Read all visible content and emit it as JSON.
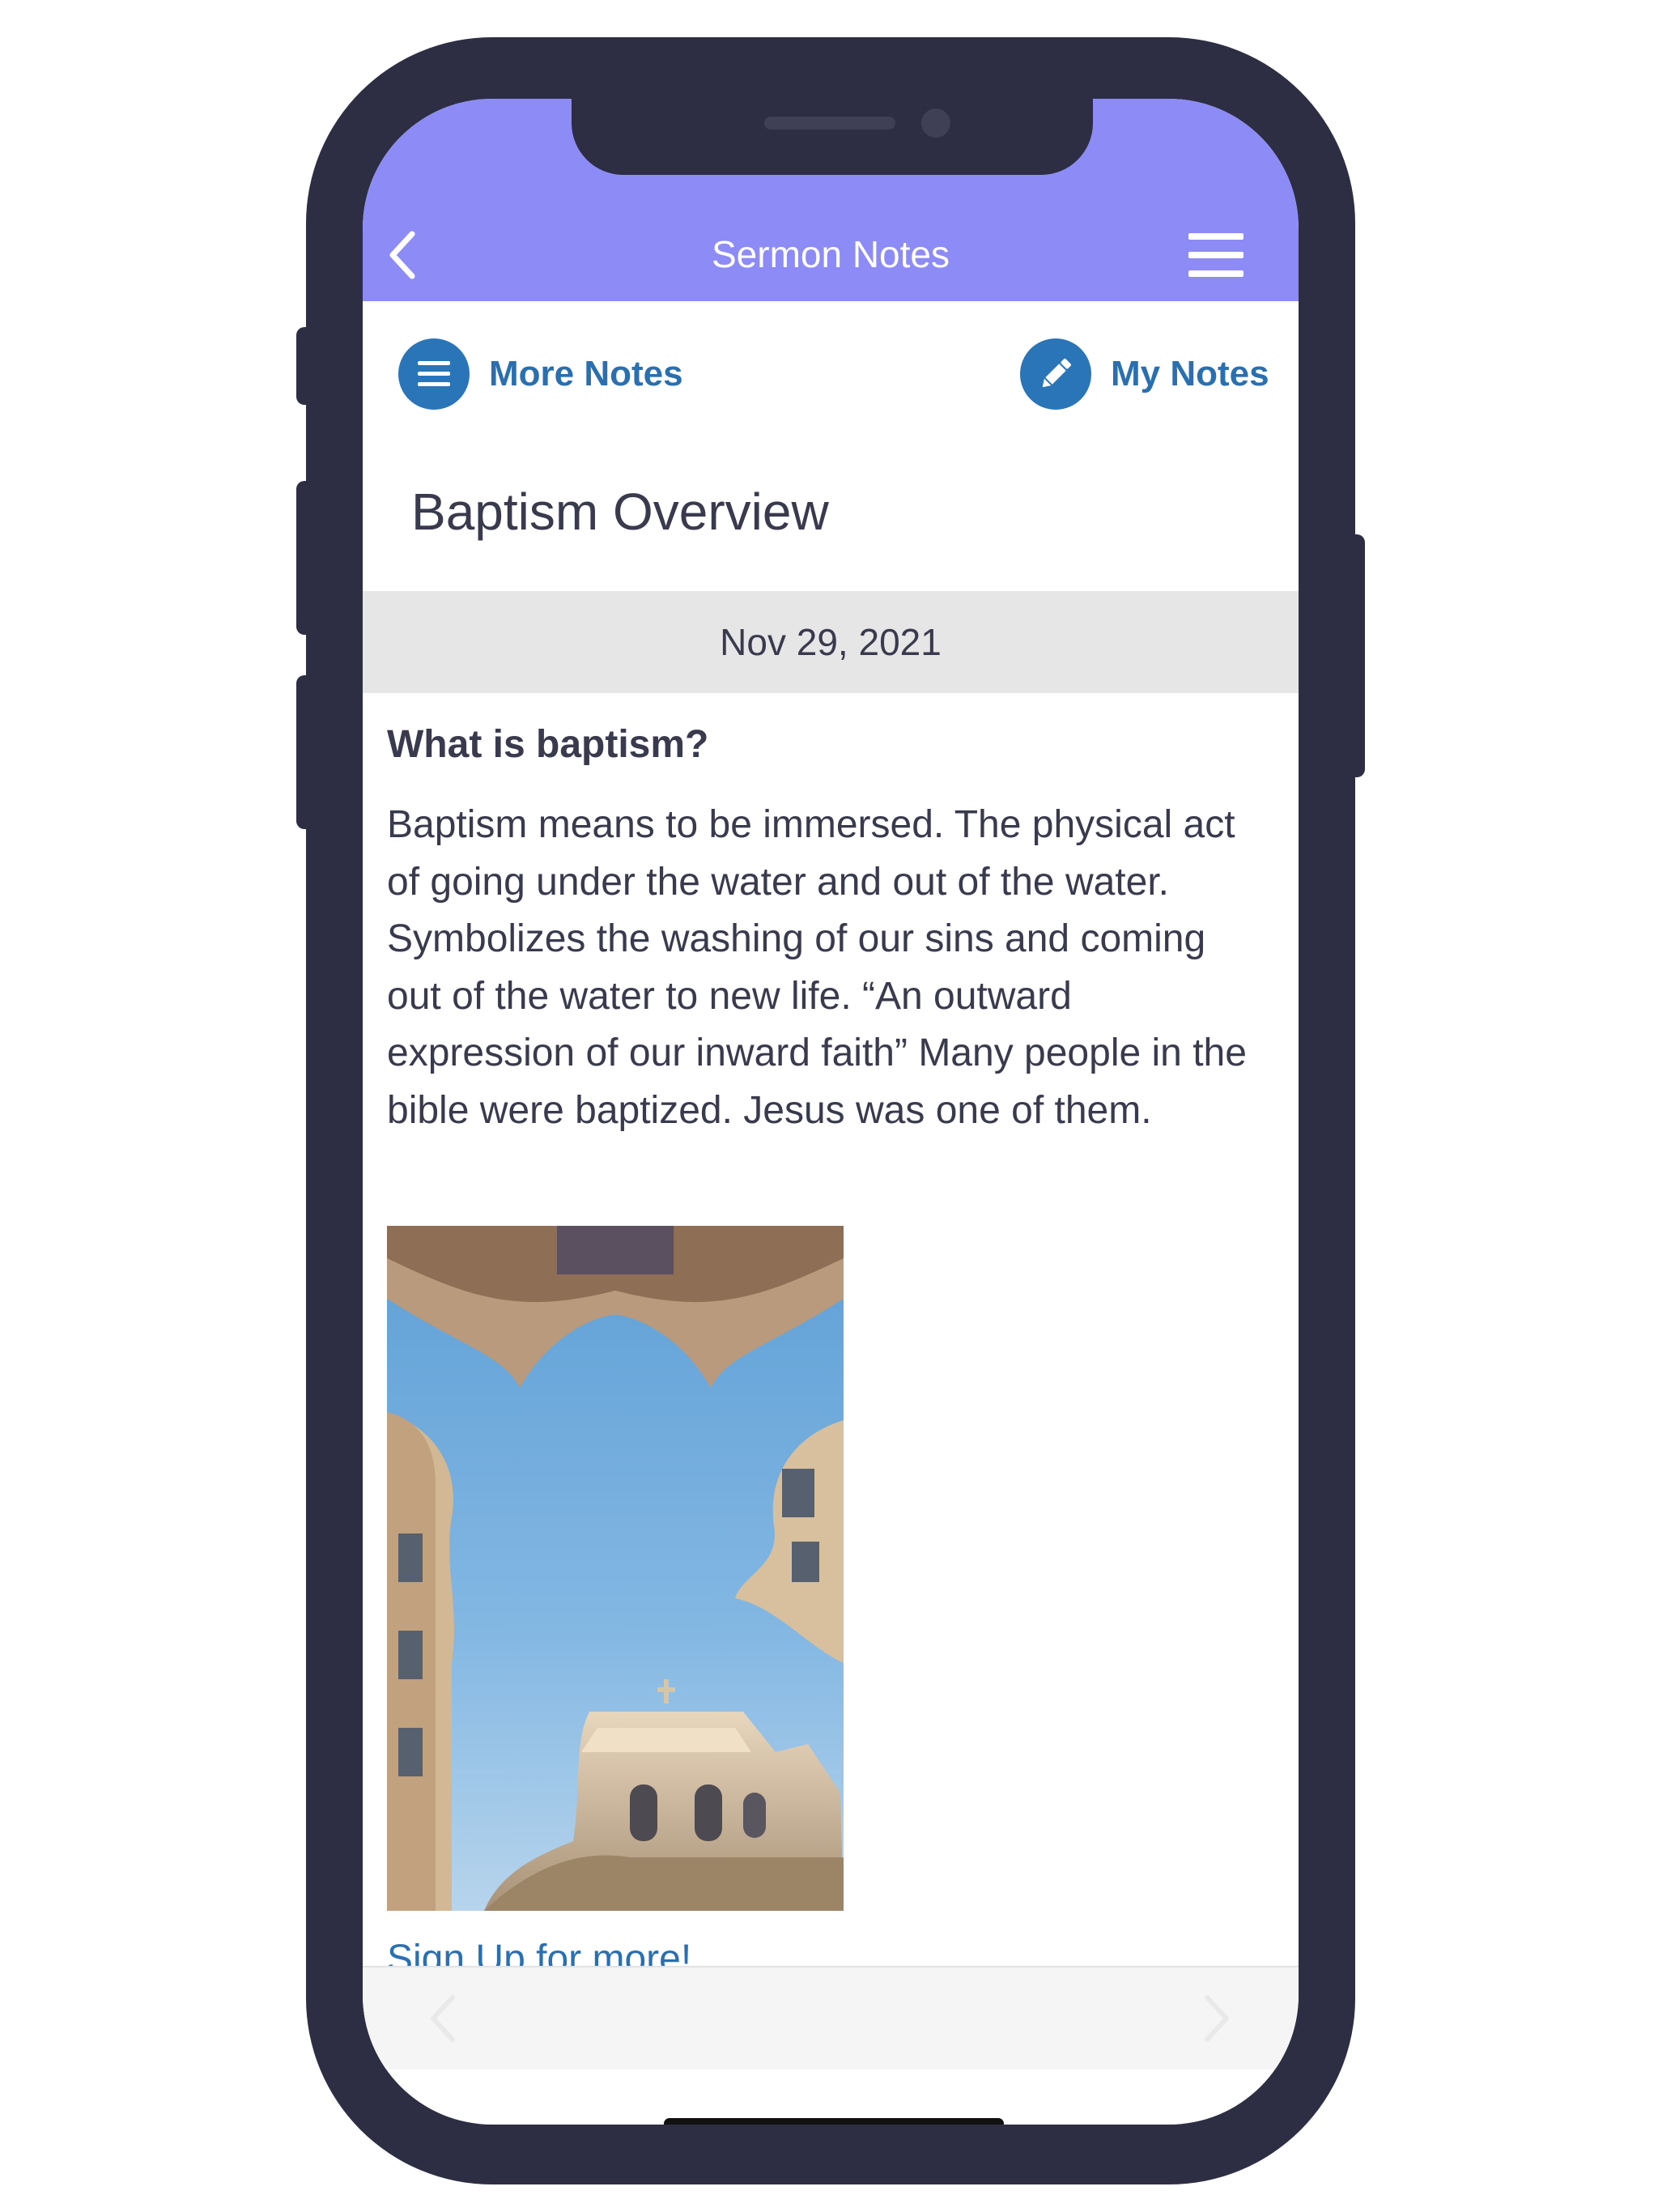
{
  "header": {
    "title": "Sermon Notes",
    "back_icon": "chevron-left-icon",
    "menu_icon": "hamburger-menu-icon",
    "background": "#8d8cf6"
  },
  "actions": {
    "more_notes": {
      "label": "More Notes",
      "icon": "list-icon"
    },
    "my_notes": {
      "label": "My Notes",
      "icon": "pencil-icon"
    },
    "accent": "#2a74b8"
  },
  "note": {
    "title": "Baptism Overview",
    "date": "Nov 29, 2021",
    "heading": "What is baptism?",
    "body": "Baptism means to be immersed. The physical act of going under the water and out of the water. Symbolizes the washing of our sins and coming out of the water to new life. “An outward expression of our inward faith” Many people in the bible were baptized. Jesus was one of them.",
    "link_text": "Sign Up for more!"
  },
  "bottom_nav": {
    "prev_icon": "chevron-left-icon",
    "next_icon": "chevron-right-icon"
  }
}
